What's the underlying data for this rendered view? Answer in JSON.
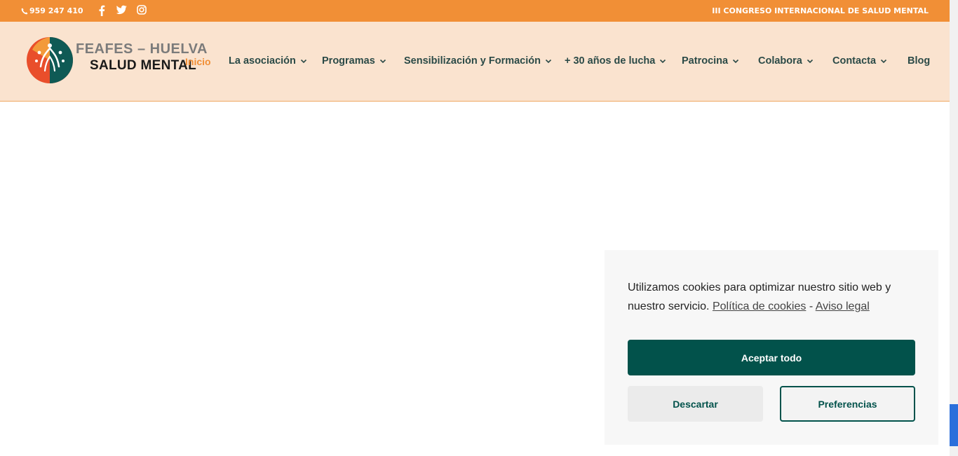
{
  "topbar": {
    "phone": "959 247 410",
    "congress_link": "III CONGRESO INTERNACIONAL DE SALUD MENTAL",
    "social": [
      "facebook-icon",
      "twitter-icon",
      "instagram-icon"
    ]
  },
  "brand": {
    "line1": "FEAFES – HUELVA",
    "line2": "SALUD MENTAL"
  },
  "nav": {
    "home": "Inicio",
    "items": [
      "La asociación",
      "Programas",
      "Sensibilización y Formación",
      "+ 30 años de lucha",
      "Patrocina",
      "Colabora",
      "Contacta",
      "Blog"
    ]
  },
  "cookie": {
    "text": "Utilizamos cookies para optimizar nuestro sitio web y nuestro servicio.",
    "policy_link": "Política de cookies",
    "separator": "-",
    "legal_link": "Aviso legal",
    "accept": "Aceptar todo",
    "dismiss": "Descartar",
    "preferences": "Preferencias"
  },
  "colors": {
    "orange": "#f18f36",
    "header_bg": "#fae3cf",
    "nav_text": "#2b4a47",
    "accent_green": "#02524b"
  }
}
